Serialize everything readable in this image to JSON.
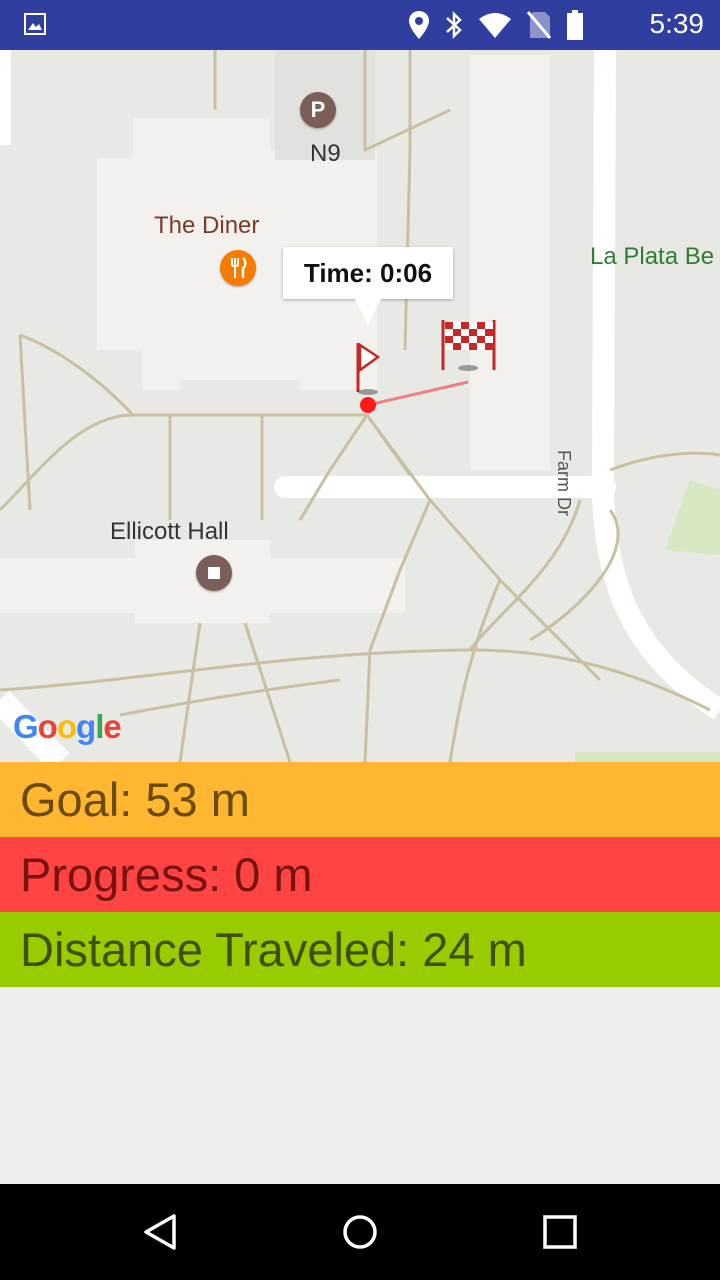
{
  "status_bar": {
    "time": "5:39",
    "icons": [
      "image-icon",
      "location-icon",
      "bluetooth-icon",
      "wifi-icon",
      "no-sim-icon",
      "battery-icon"
    ]
  },
  "map": {
    "parking_label": "N9",
    "restaurant_label": "The Diner",
    "park_label": "La Plata Be",
    "road_label": "Farm Dr",
    "building_label": "Ellicott Hall",
    "tooltip": "Time: 0:06",
    "attribution": [
      "G",
      "o",
      "o",
      "g",
      "l",
      "e"
    ],
    "attribution_colors": [
      "#4285F4",
      "#EA4335",
      "#FBBC05",
      "#4285F4",
      "#34A853",
      "#EA4335"
    ]
  },
  "stats": {
    "goal": "Goal: 53 m",
    "progress": "Progress: 0 m",
    "distance": "Distance Traveled: 24 m"
  },
  "colors": {
    "goal": "#ffb732",
    "progress": "#ff4444",
    "distance": "#99cc00",
    "status_bar": "#303f9f"
  }
}
